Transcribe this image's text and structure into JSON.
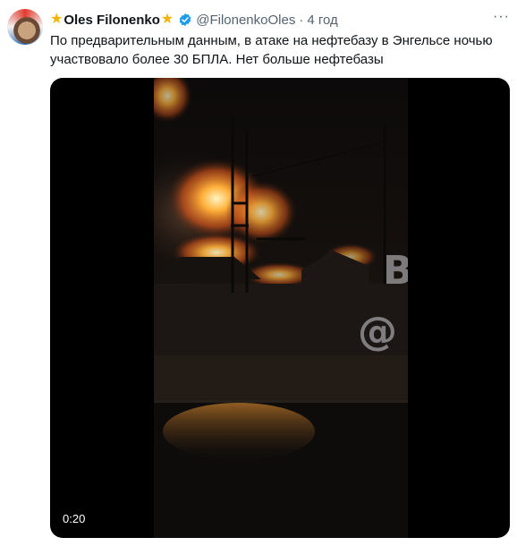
{
  "tweet": {
    "author_name": "Oles Filonenko",
    "handle": "@FilonenkoOles",
    "separator": "·",
    "time": "4 год",
    "text": "По предварительным данным, в атаке на нефтебазу в Энгельсе ночью участвовало более 30 БПЛА. Нет больше нефтебазы",
    "more_label": "···"
  },
  "media": {
    "duration": "0:20",
    "watermark_letter": "B",
    "watermark_at": "@"
  },
  "icons": {
    "name_decoration": "star-icon",
    "verified": "verified-badge-icon",
    "more": "more-options-icon"
  },
  "colors": {
    "star": "#f5b300",
    "verified": "#1d9bf0",
    "secondary_text": "#536471",
    "fire": "#ff8a1c"
  }
}
